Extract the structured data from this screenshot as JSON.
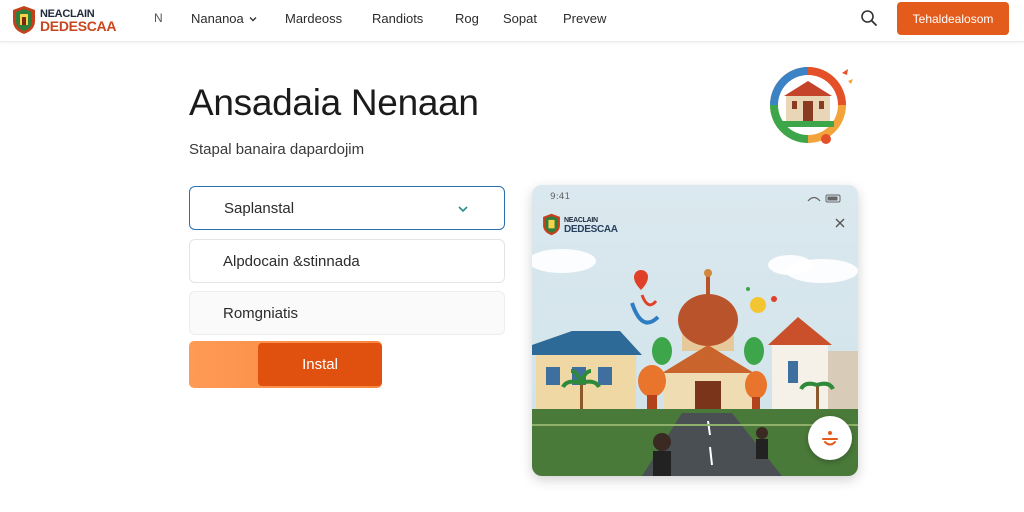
{
  "brand": {
    "line1": "NEACLAIN",
    "line2": "DEDESCAA"
  },
  "nav": {
    "items": [
      {
        "label": "N"
      },
      {
        "label": "Nananoa"
      },
      {
        "label": "Mardeoss"
      },
      {
        "label": "Randiots"
      },
      {
        "label": "Rog"
      },
      {
        "label": "Sopat"
      },
      {
        "label": "Prevew"
      }
    ],
    "cta_label": "Tehaldealosom"
  },
  "hero": {
    "title": "Ansadaia Nenaan",
    "subtitle": "Stapal banaira dapardojim"
  },
  "form": {
    "select_value": "Saplanstal",
    "option_2": "Alpdocain &stinnada",
    "option_3": "Romgniatis",
    "install_label": "Instal"
  },
  "card": {
    "status_time": "9:41",
    "logo_line1": "NEACLAIN",
    "logo_line2": "DEDESCAA"
  },
  "colors": {
    "accent": "#e45c1c",
    "select_border": "#2a6fb1",
    "brand_dark": "#1d2a3a"
  },
  "icons": {
    "search": "search-icon",
    "chevron": "chevron-down-icon",
    "close": "close-icon",
    "fab": "route-icon"
  }
}
